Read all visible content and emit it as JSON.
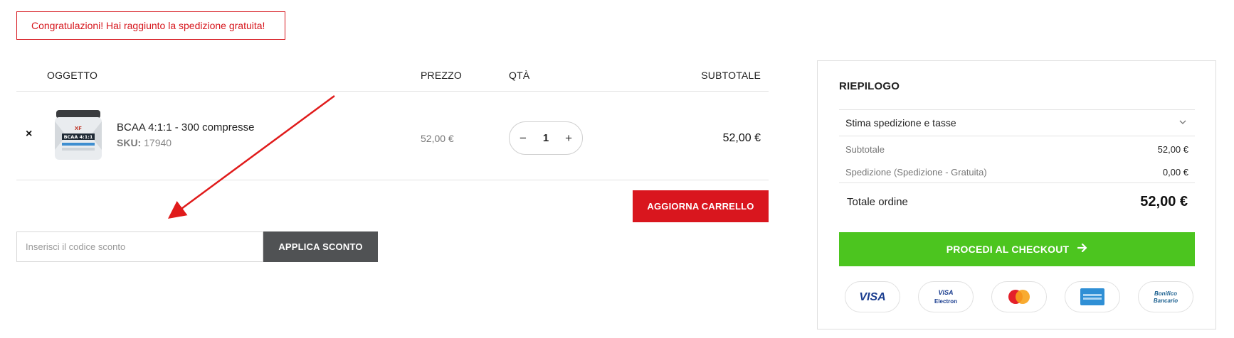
{
  "notice": "Congratulazioni! Hai raggiunto la spedizione gratuita!",
  "cart": {
    "headers": {
      "item": "OGGETTO",
      "price": "PREZZO",
      "qty": "QTÀ",
      "subtotal": "SUBTOTALE"
    },
    "item": {
      "remove": "×",
      "name": "BCAA 4:1:1 - 300 compresse",
      "sku_label": "SKU:",
      "sku": "17940",
      "price": "52,00 €",
      "qty": "1",
      "minus": "−",
      "plus": "+",
      "subtotal": "52,00 €",
      "image_label": "BCAA 4:1:1"
    },
    "update_label": "AGGIORNA CARRELLO",
    "coupon_placeholder": "Inserisci il codice sconto",
    "coupon_button": "APPLICA SCONTO"
  },
  "summary": {
    "title": "RIEPILOGO",
    "shipping_estimate": "Stima spedizione e tasse",
    "subtotal_label": "Subtotale",
    "subtotal_value": "52,00 €",
    "shipping_label": "Spedizione (Spedizione - Gratuita)",
    "shipping_value": "0,00 €",
    "total_label": "Totale ordine",
    "total_value": "52,00 €",
    "checkout_label": "PROCEDI AL CHECKOUT",
    "payments": [
      "VISA",
      "VISA Electron",
      "MasterCard",
      "American Express",
      "Bonifico Bancario"
    ],
    "payment_visa": "VISA",
    "payment_visa_electron_top": "VISA",
    "payment_visa_electron_bottom": "Electron",
    "payment_bonifico_top": "Bonifico",
    "payment_bonifico_bottom": "Bancario"
  },
  "colors": {
    "accent_red": "#d9161e",
    "checkout_green": "#4cc51f",
    "coupon_dark": "#505254"
  }
}
